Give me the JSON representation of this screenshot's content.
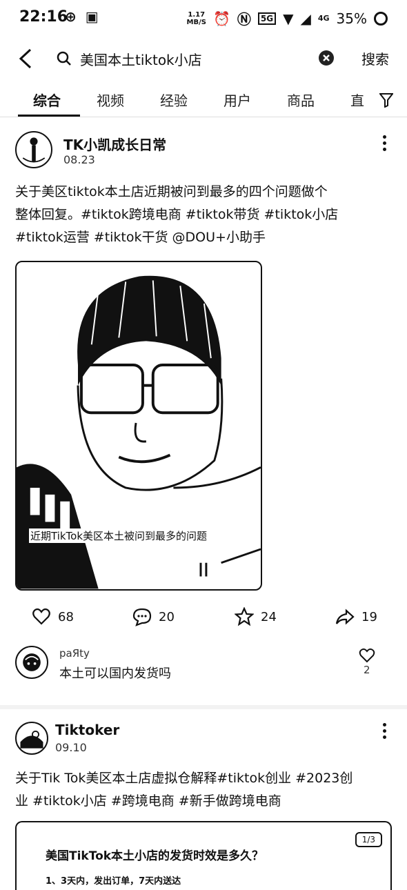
{
  "status_bar": {
    "time": "22:16",
    "network_speed_value": "1.17",
    "network_speed_unit": "MB/S",
    "network_5g": "5G",
    "network_4g": "4G",
    "battery": "35%"
  },
  "search": {
    "query": "美国本土tiktok小店",
    "search_label": "搜索"
  },
  "tabs": [
    {
      "label": "综合",
      "active": true
    },
    {
      "label": "视频",
      "active": false
    },
    {
      "label": "经验",
      "active": false
    },
    {
      "label": "用户",
      "active": false
    },
    {
      "label": "商品",
      "active": false
    },
    {
      "label": "直",
      "active": false
    }
  ],
  "posts": [
    {
      "author": "TK小凯成长日常",
      "date": "08.23",
      "text_lines": [
        "关于美区tiktok本土店近期被问到最多的四个问题做个",
        "整体回复。#tiktok跨境电商 #tiktok带货 #tiktok小店",
        "#tiktok运营 #tiktok干货 @DOU+小助手"
      ],
      "video_caption": "近期TikTok美区本土被问到最多的问题",
      "actions": {
        "likes": "68",
        "comments": "20",
        "favorites": "24",
        "shares": "19"
      },
      "top_comment": {
        "user": "paЯty",
        "text": "本土可以国内发货吗",
        "likes": "2"
      }
    },
    {
      "author": "Tiktoker",
      "date": "09.10",
      "text_lines": [
        "关于Tik Tok美区本土店虚拟仓解释#tiktok创业 #2023创",
        "业 #tiktok小店 #跨境电商 #新手做跨境电商"
      ],
      "image_title": "美国TikTok本土小店的发货时效是多久？",
      "image_line": "1、3天内，发出订单，7天内送达",
      "image_pages": "1/3"
    }
  ]
}
